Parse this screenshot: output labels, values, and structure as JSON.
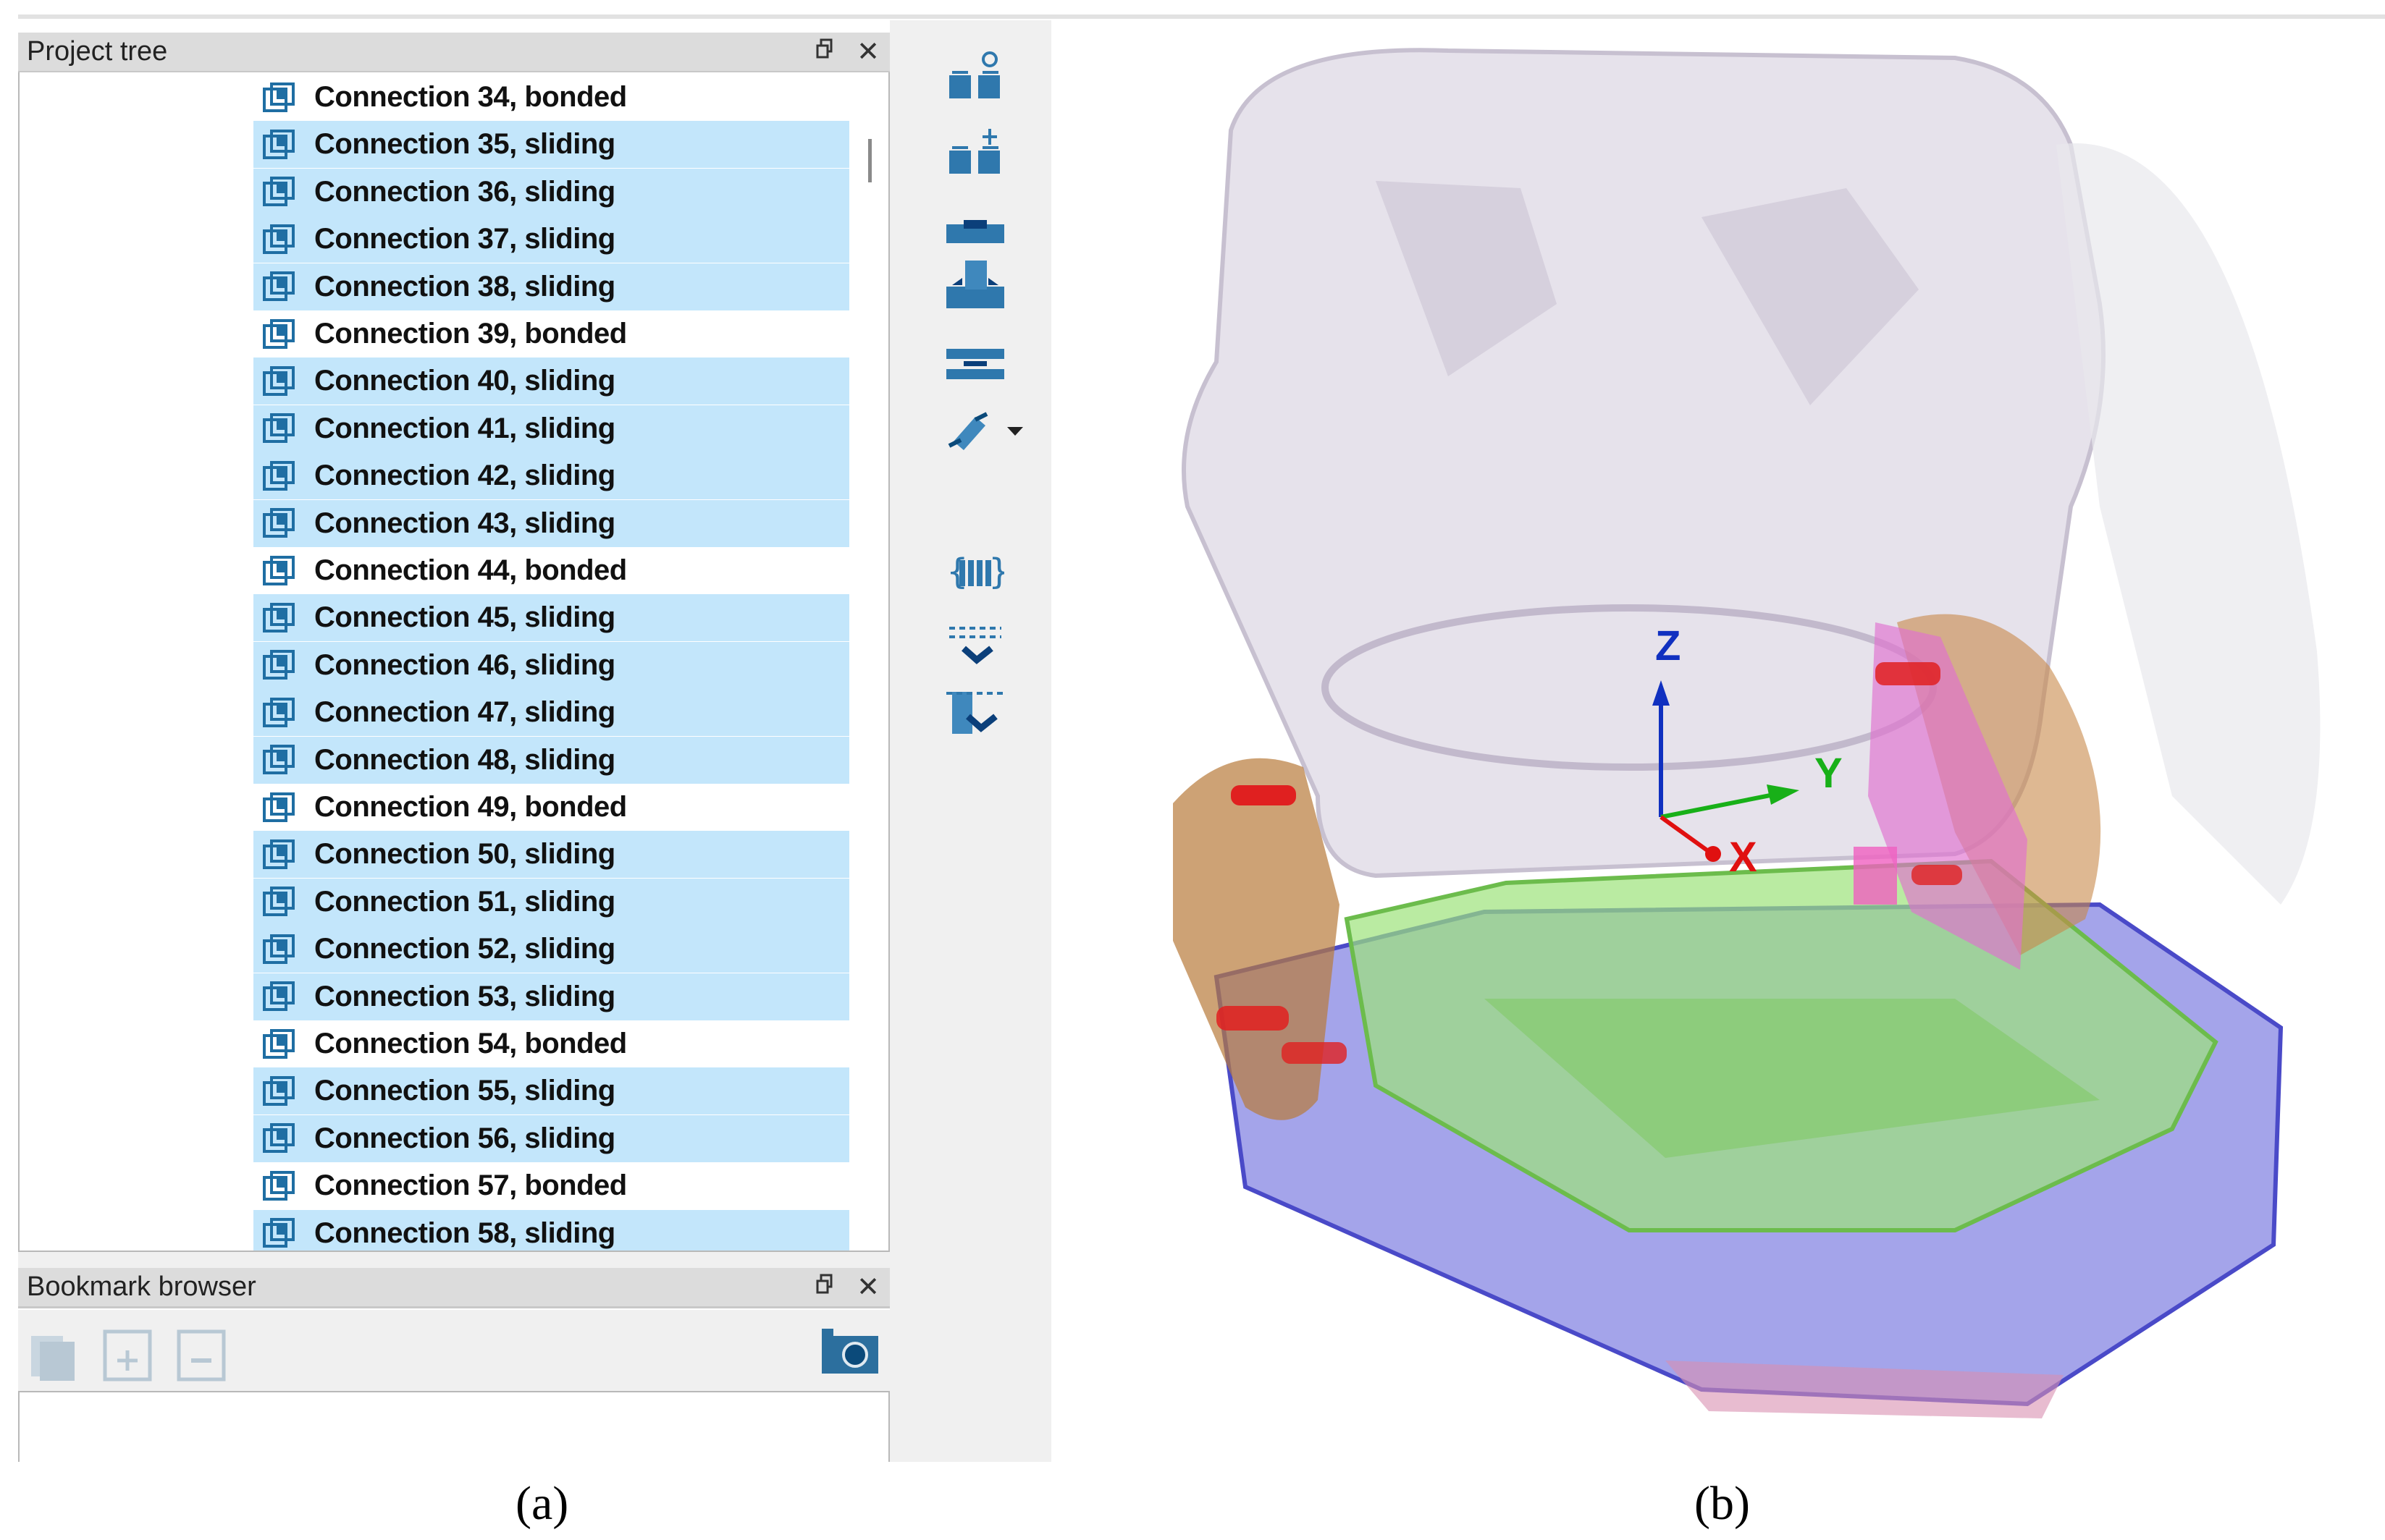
{
  "project_tree": {
    "title": "Project tree",
    "items": [
      {
        "label": "Connection 34, bonded",
        "selected": false
      },
      {
        "label": "Connection 35, sliding",
        "selected": true
      },
      {
        "label": "Connection 36, sliding",
        "selected": true
      },
      {
        "label": "Connection 37, sliding",
        "selected": true
      },
      {
        "label": "Connection 38, sliding",
        "selected": true
      },
      {
        "label": "Connection 39, bonded",
        "selected": false
      },
      {
        "label": "Connection 40, sliding",
        "selected": true
      },
      {
        "label": "Connection 41, sliding",
        "selected": true
      },
      {
        "label": "Connection 42, sliding",
        "selected": true
      },
      {
        "label": "Connection 43, sliding",
        "selected": true
      },
      {
        "label": "Connection 44, bonded",
        "selected": false
      },
      {
        "label": "Connection 45, sliding",
        "selected": true
      },
      {
        "label": "Connection 46, sliding",
        "selected": true
      },
      {
        "label": "Connection 47, sliding",
        "selected": true
      },
      {
        "label": "Connection 48, sliding",
        "selected": true
      },
      {
        "label": "Connection 49, bonded",
        "selected": false
      },
      {
        "label": "Connection 50, sliding",
        "selected": true
      },
      {
        "label": "Connection 51, sliding",
        "selected": true
      },
      {
        "label": "Connection 52, sliding",
        "selected": true
      },
      {
        "label": "Connection 53, sliding",
        "selected": true
      },
      {
        "label": "Connection 54, bonded",
        "selected": false
      },
      {
        "label": "Connection 55, sliding",
        "selected": true
      },
      {
        "label": "Connection 56, sliding",
        "selected": true
      },
      {
        "label": "Connection 57, bonded",
        "selected": false
      },
      {
        "label": "Connection 58, sliding",
        "selected": true
      }
    ],
    "float_icon": "restore-icon",
    "close_label": "✕"
  },
  "bookmark_browser": {
    "title": "Bookmark browser",
    "close_label": "✕"
  },
  "viewport": {
    "axes": {
      "x": "X",
      "y": "Y",
      "z": "Z"
    }
  },
  "captions": {
    "a": "(a)",
    "b": "(b)"
  },
  "colors": {
    "selection": "#c3e6fb",
    "icon_blue": "#1f6ea3",
    "x_axis": "#e01010",
    "y_axis": "#18b018",
    "z_axis": "#1030c0"
  }
}
